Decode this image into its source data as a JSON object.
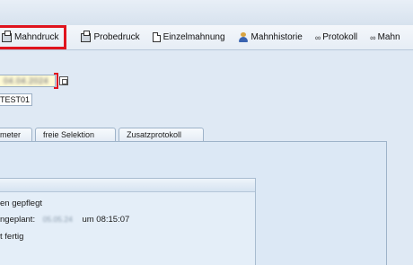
{
  "toolbar": {
    "items": [
      {
        "label": "Mahndruck",
        "icon": "print-icon",
        "highlighted": true
      },
      {
        "label": "Probedruck",
        "icon": "print-icon"
      },
      {
        "label": "Einzelmahnung",
        "icon": "document-icon"
      },
      {
        "label": "Mahnhistorie",
        "icon": "person-history-icon"
      },
      {
        "label": "Protokoll",
        "icon": "glasses-icon"
      },
      {
        "label": "Mahn",
        "icon": "glasses-icon"
      }
    ],
    "highlight_color": "#e0141e"
  },
  "form": {
    "date_value": "04.04.2024",
    "run_id": "TEST01"
  },
  "tabs": [
    {
      "label": "meter"
    },
    {
      "label": "freie Selektion"
    },
    {
      "label": "Zusatzprotokoll"
    }
  ],
  "status": {
    "line1": "en gepflegt",
    "line2_prefix": "ngeplant:",
    "line2_date": "05.05.24",
    "line2_time": "um 08:15:07",
    "line3": "t fertig"
  }
}
